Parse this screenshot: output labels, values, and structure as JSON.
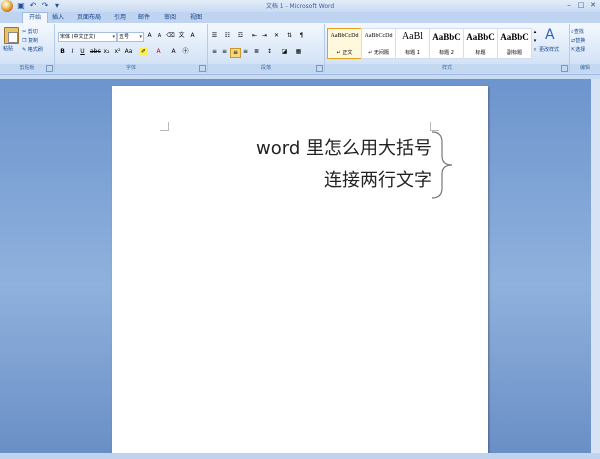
{
  "window": {
    "title": "文档 1 - Microsoft Word"
  },
  "tabs": [
    "开始",
    "插入",
    "页面布局",
    "引用",
    "邮件",
    "审阅",
    "视图"
  ],
  "clipboard": {
    "paste": "粘贴",
    "cut": "剪切",
    "copy": "复制",
    "format_painter": "格式刷",
    "label": "剪贴板"
  },
  "font": {
    "name": "宋体 (中文正文)",
    "size": "五号",
    "label": "字体"
  },
  "paragraph": {
    "label": "段落"
  },
  "styles": {
    "label": "样式",
    "items": [
      {
        "sample": "AaBbCcDd",
        "name": "↵ 正文"
      },
      {
        "sample": "AaBbCcDd",
        "name": "↵ 无间隔"
      },
      {
        "sample": "AaBl",
        "name": "标题 1"
      },
      {
        "sample": "AaBbC",
        "name": "标题 2"
      },
      {
        "sample": "AaBbC",
        "name": "标题"
      },
      {
        "sample": "AaBbC",
        "name": "副标题"
      }
    ],
    "change_styles": "更改样式"
  },
  "editing": {
    "find": "查找",
    "replace": "替换",
    "select": "选择",
    "label": "编辑"
  },
  "document": {
    "line1": "word 里怎么用大括号",
    "line2": "连接两行文字"
  }
}
